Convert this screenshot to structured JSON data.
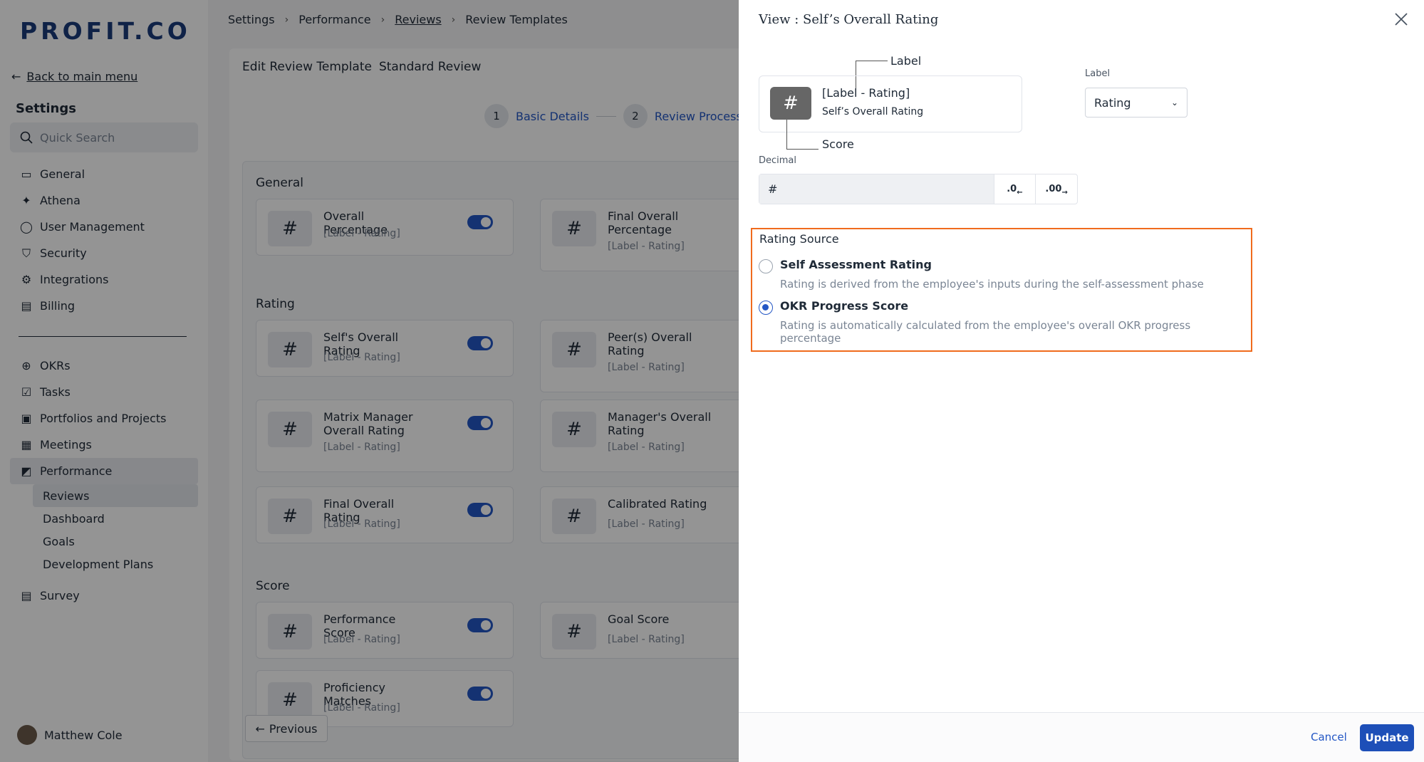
{
  "brand": {
    "logo": "PROFIT.CO"
  },
  "sidebar": {
    "back_label": "Back to main menu",
    "title": "Settings",
    "search_placeholder": "Quick Search",
    "items_top": [
      {
        "label": "General",
        "icon": "monitor-icon"
      },
      {
        "label": "Athena",
        "icon": "sparkle-icon"
      },
      {
        "label": "User Management",
        "icon": "user-icon"
      },
      {
        "label": "Security",
        "icon": "shield-icon"
      },
      {
        "label": "Integrations",
        "icon": "gear-icon"
      },
      {
        "label": "Billing",
        "icon": "receipt-icon"
      }
    ],
    "items_bottom": [
      {
        "label": "OKRs",
        "icon": "target-icon"
      },
      {
        "label": "Tasks",
        "icon": "clipboard-check-icon"
      },
      {
        "label": "Portfolios and Projects",
        "icon": "briefcase-icon"
      },
      {
        "label": "Meetings",
        "icon": "calendar-icon"
      },
      {
        "label": "Performance",
        "icon": "chart-icon"
      }
    ],
    "performance_sub": [
      "Reviews",
      "Dashboard",
      "Goals",
      "Development Plans"
    ],
    "survey": {
      "label": "Survey",
      "icon": "survey-icon"
    },
    "user_name": "Matthew Cole"
  },
  "breadcrumb": [
    "Settings",
    "Performance",
    "Reviews",
    "Review Templates"
  ],
  "template": {
    "edit_label": "Edit Review Template",
    "name": "Standard Review",
    "steps": [
      {
        "num": "1",
        "label": "Basic Details"
      },
      {
        "num": "2",
        "label": "Review Process"
      }
    ],
    "sections": {
      "general": "General",
      "rating": "Rating",
      "score": "Score"
    },
    "tiles": [
      {
        "title": "Overall Percentage",
        "sub": "[Label - Rating]"
      },
      {
        "title": "Final Overall Percentage",
        "sub": "[Label - Rating]"
      },
      {
        "title": "Self's Overall Rating",
        "sub": "[Label - Rating]"
      },
      {
        "title": "Peer(s) Overall Rating",
        "sub": "[Label - Rating]"
      },
      {
        "title": "Matrix Manager Overall Rating",
        "sub": "[Label - Rating]"
      },
      {
        "title": "Manager's Overall Rating",
        "sub": "[Label - Rating]"
      },
      {
        "title": "Final Overall Rating",
        "sub": "[Label - Rating]"
      },
      {
        "title": "Calibrated Rating",
        "sub": "[Label - Rating]"
      },
      {
        "title": "Performance Score",
        "sub": "[Label - Rating]"
      },
      {
        "title": "Goal Score",
        "sub": "[Label - Rating]"
      },
      {
        "title": "Proficiency Matches",
        "sub": "[Label - Rating]"
      }
    ],
    "hash": "#",
    "previous_label": "Previous"
  },
  "drawer": {
    "title": "View : Self’s Overall Rating",
    "preview_hash": "#",
    "preview_title": "[Label - Rating]",
    "preview_sub": "Self’s Overall Rating",
    "callout_label": "Label",
    "callout_score": "Score",
    "label_field_label": "Label",
    "label_field_value": "Rating",
    "decimal_label": "Decimal",
    "decimal_value": "#",
    "decimal_decrease": ".0",
    "decimal_increase": ".00",
    "rating_source_title": "Rating Source",
    "options": [
      {
        "title": "Self Assessment Rating",
        "desc": "Rating is derived from the employee's inputs during the self-assessment phase",
        "checked": false
      },
      {
        "title": "OKR Progress Score",
        "desc": "Rating is automatically calculated from the employee's overall OKR progress percentage",
        "checked": true
      }
    ],
    "cancel_label": "Cancel",
    "update_label": "Update"
  },
  "colors": {
    "accent": "#2457c5",
    "highlight": "#f06b1d",
    "brand": "#1a3c7a"
  }
}
